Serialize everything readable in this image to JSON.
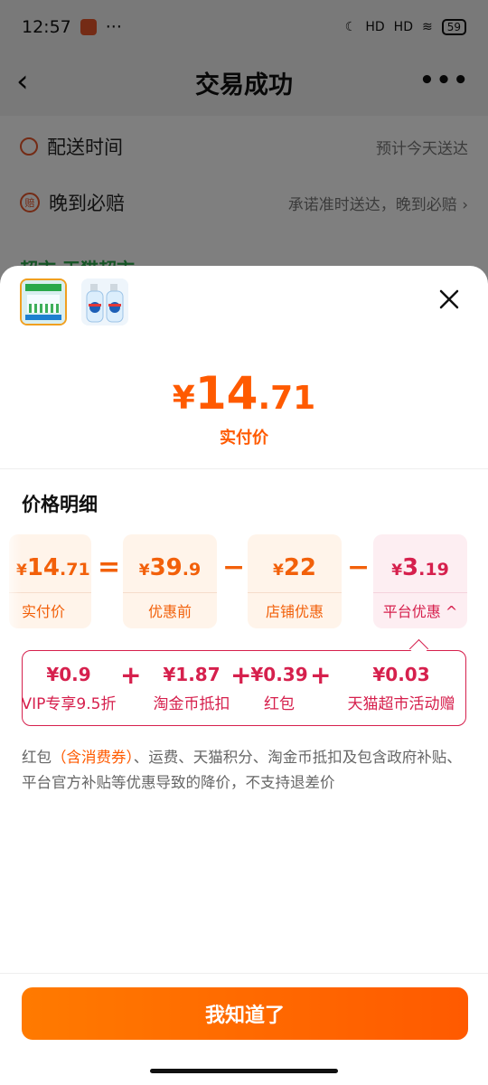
{
  "status": {
    "time": "12:57",
    "dots": "···",
    "net1": "HD",
    "net2": "HD",
    "battery": "59"
  },
  "nav": {
    "back": "‹",
    "title": "交易成功",
    "more": "•••"
  },
  "order": {
    "rows": [
      {
        "label": "配送时间",
        "value": "预计今天送达"
      },
      {
        "label": "晚到必赔",
        "badge": "赔",
        "value": "承诺准时送达，晚到必赔 ›"
      }
    ],
    "peek": "超市 天猫超市"
  },
  "sheet": {
    "close": "close",
    "price": {
      "symbol": "¥",
      "int": "14",
      "dec": ".71",
      "caption": "实付价"
    },
    "section_title": "价格明细",
    "boxes": [
      {
        "symbol": "¥",
        "int": "14",
        "dec": ".71",
        "label": "实付价"
      },
      {
        "symbol": "¥",
        "int": "39",
        "dec": ".9",
        "label": "优惠前"
      },
      {
        "symbol": "¥",
        "int": "22",
        "dec": "",
        "label": "店铺优惠"
      },
      {
        "symbol": "¥",
        "int": "3",
        "dec": ".19",
        "label": "平台优惠 ^"
      }
    ],
    "ops": [
      "=",
      "−",
      "−"
    ],
    "platform_items": [
      {
        "value": "¥0.9",
        "label": "VIP专享9.5折"
      },
      {
        "value": "¥1.87",
        "label": "淘金币抵扣"
      },
      {
        "value": "¥0.39",
        "label": "红包"
      },
      {
        "value": "¥0.03",
        "label": "天猫超市活动赠"
      }
    ],
    "plus": "+",
    "note_pre": "红包",
    "note_hl": "（含消费券）",
    "note_post": "、运费、天猫积分、淘金币抵扣及包含政府补贴、平台官方补贴等优惠导致的降价，不支持退差价",
    "ok_button": "我知道了"
  }
}
